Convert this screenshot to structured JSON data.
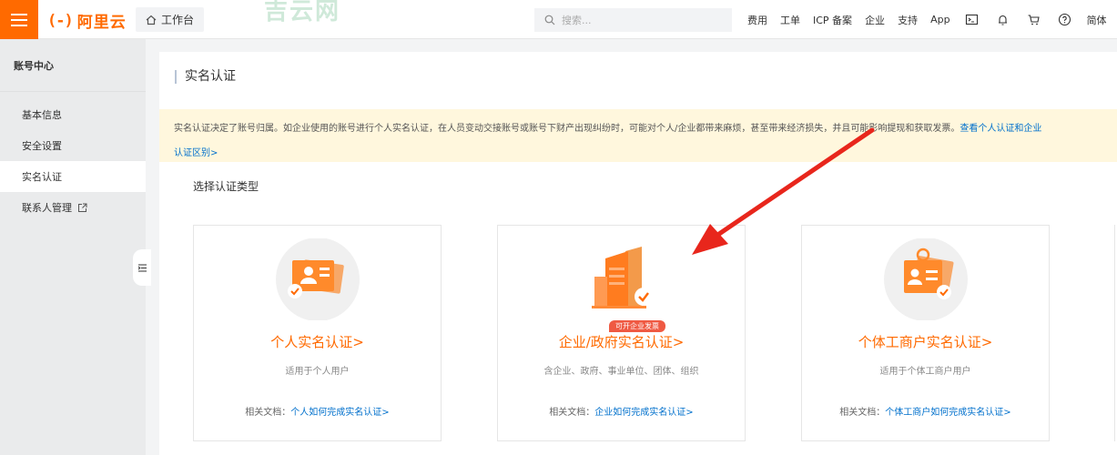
{
  "header": {
    "logo_mark": "(-)",
    "logo_name": "阿里云",
    "workbench_label": "工作台",
    "watermark": "吉云网",
    "search_placeholder": "搜索...",
    "nav": [
      "费用",
      "工单",
      "ICP 备案",
      "企业",
      "支持",
      "App"
    ],
    "nav_icons": [
      "terminal-icon",
      "bell-icon",
      "cart-icon",
      "help-icon"
    ],
    "language": "简体"
  },
  "sidebar": {
    "title": "账号中心",
    "items": [
      {
        "label": "基本信息",
        "active": false
      },
      {
        "label": "安全设置",
        "active": false
      },
      {
        "label": "实名认证",
        "active": true
      },
      {
        "label": "联系人管理",
        "active": false,
        "icon": "external-link-icon"
      }
    ]
  },
  "main": {
    "page_title": "实名认证",
    "notice": {
      "text": "实名认证决定了账号归属。如企业使用的账号进行个人实名认证，在人员变动交接账号或账号下财产出现纠纷时，可能对个人/企业都带来麻烦，甚至带来经济损失，并且可能影响提现和获取发票。",
      "link_part1": "查看个人认证和企业",
      "link_part2": "认证区别>"
    },
    "section_title": "选择认证类型",
    "cards": [
      {
        "title": "个人实名认证>",
        "desc": "适用于个人用户",
        "doc_label": "相关文档：",
        "doc_link": "个人如何完成实名认证>",
        "icon": "person-id-card-icon"
      },
      {
        "title": "企业/政府实名认证>",
        "desc": "含企业、政府、事业单位、团体、组织",
        "doc_label": "相关文档：",
        "doc_link": "企业如何完成实名认证>",
        "icon": "building-icon",
        "badge": "可开企业发票"
      },
      {
        "title": "个体工商户实名认证>",
        "desc": "适用于个体工商户用户",
        "doc_label": "相关文档：",
        "doc_link": "个体工商户如何完成实名认证>",
        "icon": "merchant-badge-icon"
      }
    ]
  },
  "colors": {
    "accent": "#ff6a00",
    "link": "#0070cc",
    "notice_bg": "#fff7dd",
    "arrow": "#e8261c"
  }
}
